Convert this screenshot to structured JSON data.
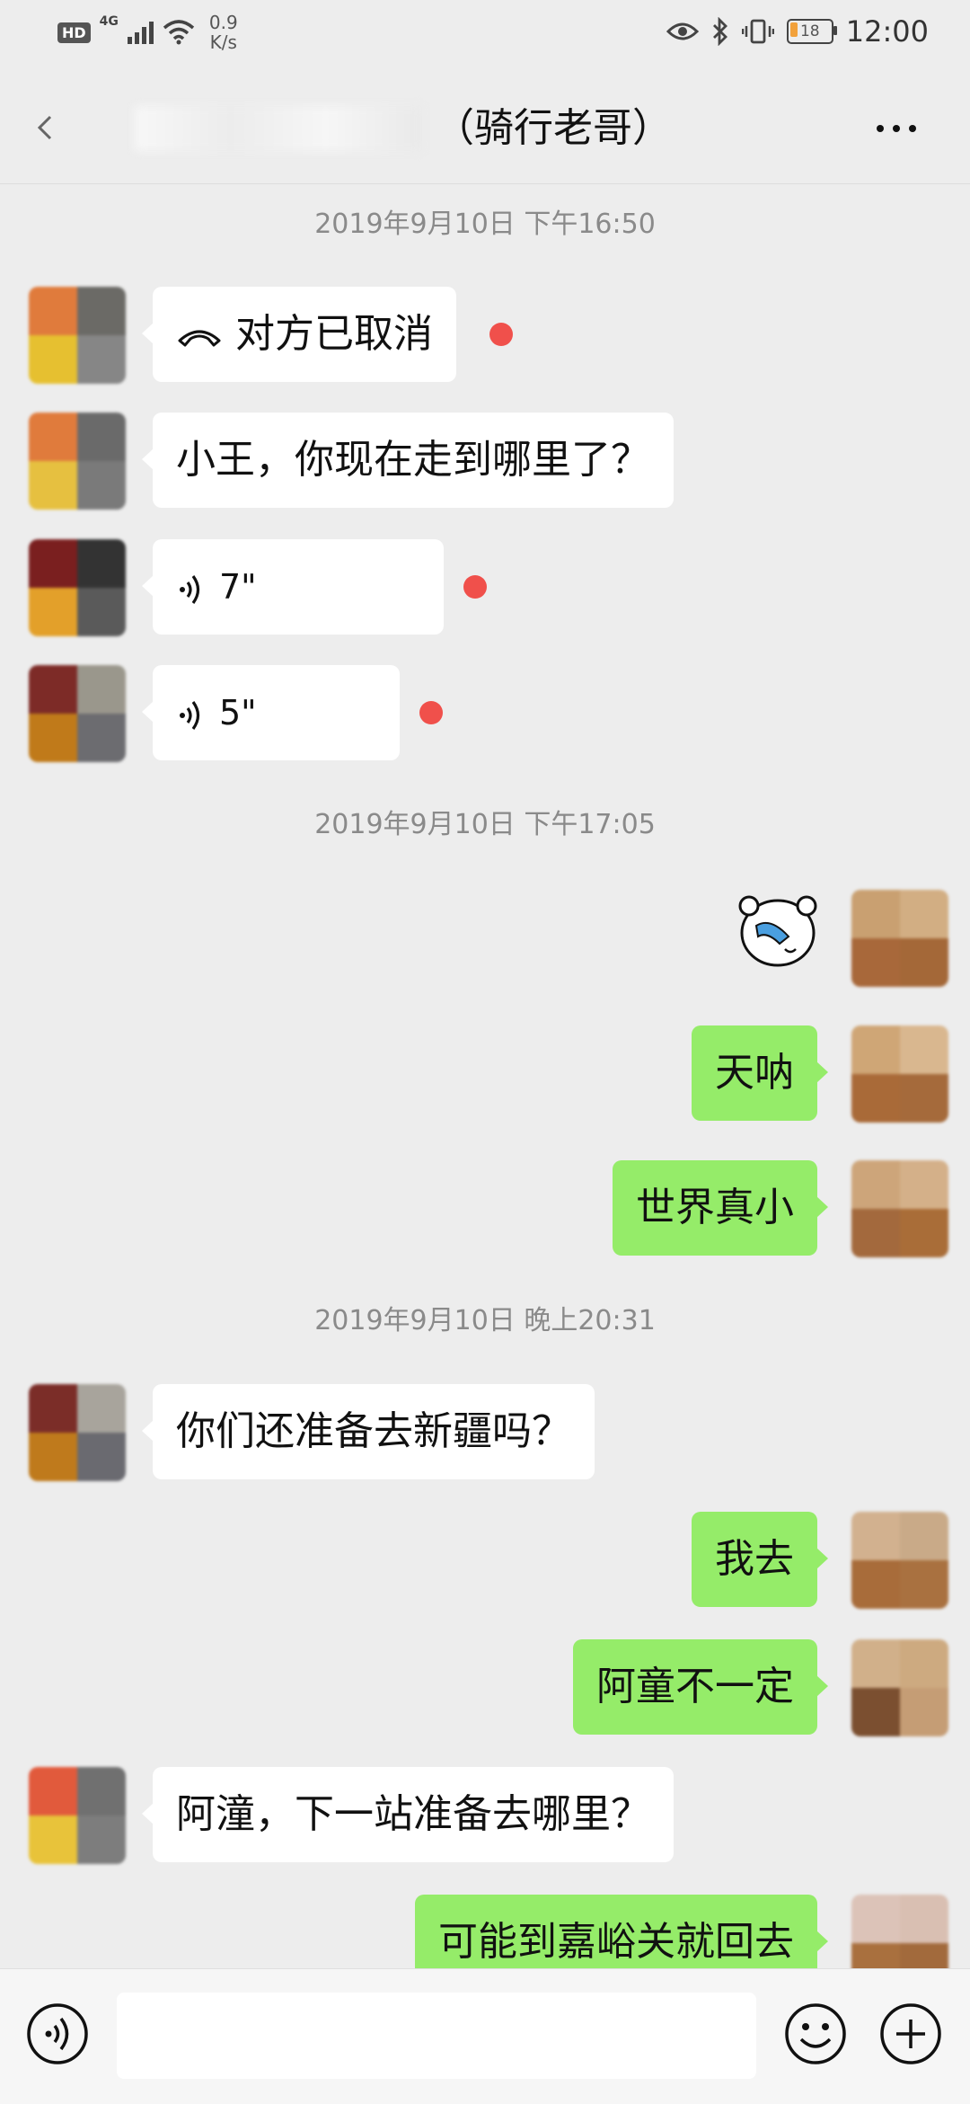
{
  "status_bar": {
    "hd": "HD",
    "network": "4G",
    "speed_value": "0.9",
    "speed_unit": "K/s",
    "battery": "18",
    "time": "12:00",
    "icons": [
      "eye-icon",
      "bluetooth-icon",
      "vibrate-icon",
      "battery-icon"
    ]
  },
  "header": {
    "title": "（骑行老哥）",
    "back_icon": "chevron-left-icon",
    "more_icon": "more-dots-icon"
  },
  "timestamps": [
    "2019年9月10日 下午16:50",
    "2019年9月10日 下午17:05",
    "2019年9月10日 晚上20:31"
  ],
  "messages": [
    {
      "side": "in",
      "type": "call",
      "text": "对方已取消",
      "unread": true
    },
    {
      "side": "in",
      "type": "text",
      "text": "小王，你现在走到哪里了？"
    },
    {
      "side": "in",
      "type": "voice",
      "text": "7\"",
      "unread": true
    },
    {
      "side": "in",
      "type": "voice",
      "text": "5\"",
      "unread": true
    },
    {
      "side": "out",
      "type": "sticker",
      "text": ""
    },
    {
      "side": "out",
      "type": "text",
      "text": "天呐"
    },
    {
      "side": "out",
      "type": "text",
      "text": "世界真小"
    },
    {
      "side": "in",
      "type": "text",
      "text": "你们还准备去新疆吗？"
    },
    {
      "side": "out",
      "type": "text",
      "text": "我去"
    },
    {
      "side": "out",
      "type": "text",
      "text": "阿童不一定"
    },
    {
      "side": "in",
      "type": "text",
      "text": "阿潼，下一站准备去哪里？"
    },
    {
      "side": "out",
      "type": "text",
      "text": "可能到嘉峪关就回去"
    }
  ],
  "input_bar": {
    "value": "",
    "voice_icon": "voice-mode-icon",
    "emoji_icon": "emoji-icon",
    "plus_icon": "plus-icon"
  },
  "colors": {
    "background": "#ededed",
    "incoming_bubble": "#ffffff",
    "outgoing_bubble": "#95ec69",
    "unread_dot": "#f0504b",
    "timestamp_text": "#8a8a8a"
  }
}
